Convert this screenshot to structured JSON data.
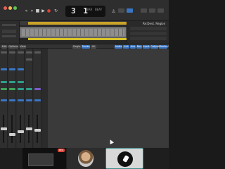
{
  "window": {
    "title": ""
  },
  "transport": {
    "bar": "3",
    "beat": "1",
    "sub_labels": [
      "BAR",
      "BEAT"
    ]
  },
  "region_panel": {
    "title": "Re:Devt. Region"
  },
  "mixer_bar": {
    "buttons": [
      "Edit",
      "Options",
      "View",
      "Single",
      "Tracks",
      "All",
      "Audio",
      "Inst",
      "Aux",
      "Bus",
      "Input",
      "Output",
      "Master/VCA",
      "MIDI"
    ]
  },
  "mixer": {
    "strips": [
      {
        "name": ""
      },
      {
        "name": ""
      },
      {
        "name": ""
      },
      {
        "name": ""
      },
      {
        "name": ""
      }
    ]
  },
  "thumbnails": {
    "badge": "REC"
  },
  "colors": {
    "accent_blue": "#3a76c4",
    "cycle_yellow": "#c9a227",
    "record_red": "#e0443a",
    "teal": "#2f9e8a"
  },
  "icons": [
    "rewind-icon",
    "forward-icon",
    "stop-icon",
    "play-icon",
    "record-icon",
    "cycle-icon",
    "metronome-icon",
    "pointer-icon"
  ]
}
